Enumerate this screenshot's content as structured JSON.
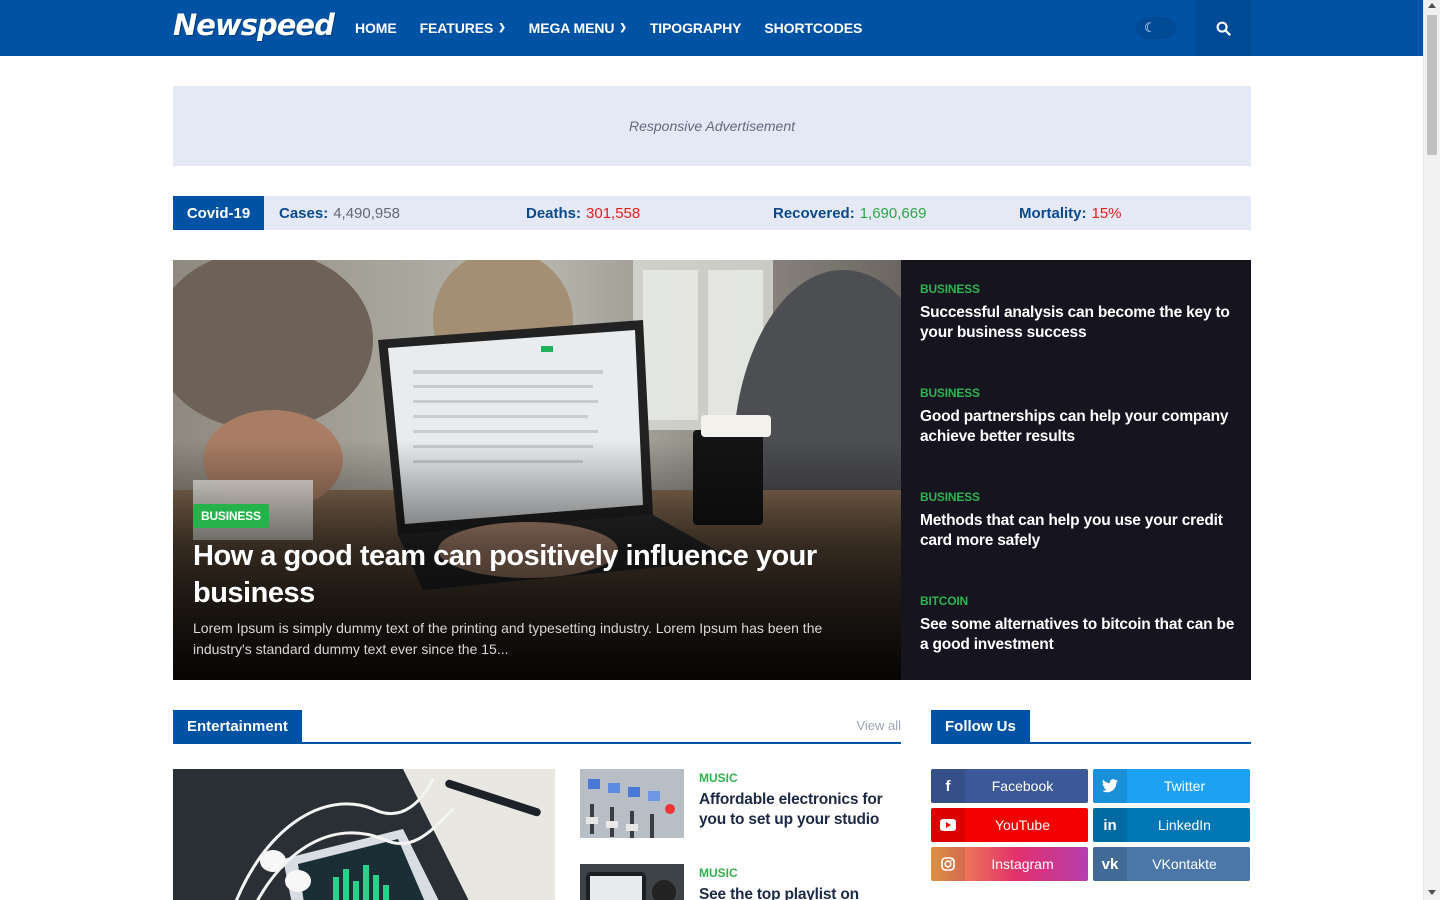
{
  "header": {
    "logo": "Newspeed",
    "nav": [
      {
        "label": "HOME",
        "has_dropdown": false
      },
      {
        "label": "FEATURES",
        "has_dropdown": true
      },
      {
        "label": "MEGA MENU",
        "has_dropdown": true
      },
      {
        "label": "TIPOGRAPHY",
        "has_dropdown": false
      },
      {
        "label": "SHORTCODES",
        "has_dropdown": false
      }
    ],
    "dark_mode_icon": "moon-icon",
    "search_icon": "search-icon"
  },
  "ad": {
    "text": "Responsive Advertisement"
  },
  "covid": {
    "title": "Covid-19",
    "stats": [
      {
        "label": "Cases:",
        "value": "4,490,958",
        "color": "#606a78"
      },
      {
        "label": "Deaths:",
        "value": "301,558",
        "color": "#e0201f"
      },
      {
        "label": "Recovered:",
        "value": "1,690,669",
        "color": "#29a745"
      },
      {
        "label": "Mortality:",
        "value": "15%",
        "color": "#e0201f"
      }
    ]
  },
  "hero": {
    "category": "BUSINESS",
    "title": "How a good team can positively influence your business",
    "excerpt": "Lorem Ipsum is simply dummy text of the printing and typesetting industry. Lorem Ipsum has been the industry's standard dummy text ever since the 15..."
  },
  "side_posts": [
    {
      "category": "BUSINESS",
      "title": "Successful analysis can become the key to your business success"
    },
    {
      "category": "BUSINESS",
      "title": "Good partnerships can help your company achieve better results"
    },
    {
      "category": "BUSINESS",
      "title": "Methods that can help you use your credit card more safely"
    },
    {
      "category": "BITCOIN",
      "title": "See some alternatives to bitcoin that can be a good investment"
    }
  ],
  "entertainment": {
    "heading": "Entertainment",
    "view_all": "View all",
    "posts": [
      {
        "category": "MUSIC",
        "title": "Affordable electronics for you to set up your studio"
      },
      {
        "category": "MUSIC",
        "title": "See the top playlist on"
      }
    ]
  },
  "follow": {
    "heading": "Follow Us",
    "networks": [
      {
        "label": "Facebook",
        "icon": "facebook-icon",
        "color": "#3b5998"
      },
      {
        "label": "Twitter",
        "icon": "twitter-icon",
        "color": "#1da1f2"
      },
      {
        "label": "YouTube",
        "icon": "youtube-icon",
        "color": "#f50000"
      },
      {
        "label": "LinkedIn",
        "icon": "linkedin-icon",
        "color": "#0077b5"
      },
      {
        "label": "Instagram",
        "icon": "instagram-icon",
        "color": "#e1306c"
      },
      {
        "label": "VKontakte",
        "icon": "vk-icon",
        "color": "#4a76a8"
      }
    ]
  },
  "colors": {
    "primary": "#0052a5",
    "category_green": "#2fb34e",
    "dark_panel": "#15141f"
  }
}
